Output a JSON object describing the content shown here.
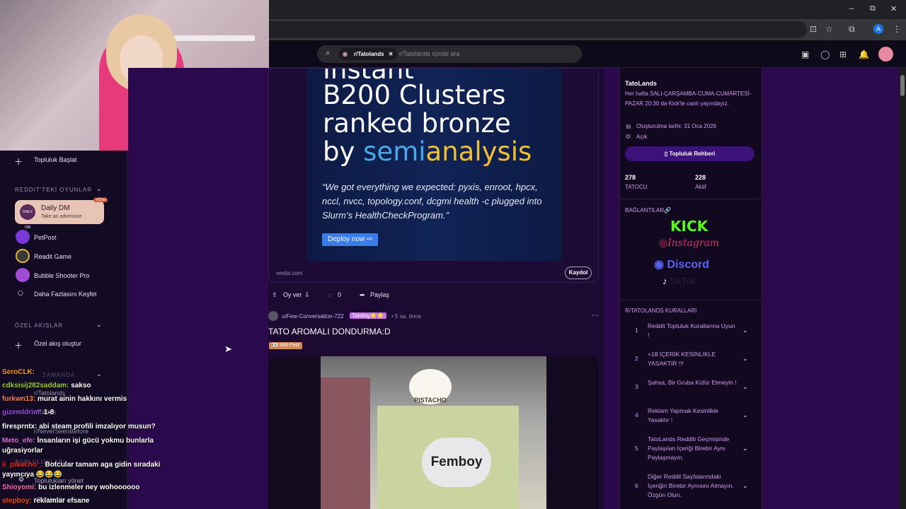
{
  "browser": {
    "minimize": "–",
    "restore": "⧉",
    "close": "✕",
    "avatar_letter": "A"
  },
  "search": {
    "community": "r/Tatolands",
    "placeholder": "r/Tatolands içinde ara"
  },
  "left_nav": {
    "start_community": "Topluluk Başlat",
    "games_header": "REDDIT'TEKİ OYUNLAR",
    "daily_dm": {
      "title": "Daily DM",
      "subtitle": "Take an adventure",
      "badge": "YENİ",
      "icon_text": "DAILY DM"
    },
    "games": [
      {
        "label": "PetPost"
      },
      {
        "label": "Readit Game"
      },
      {
        "label": "Bubble Shooter Pro"
      },
      {
        "label": "Daha Fazlasını Keşfet"
      }
    ],
    "feeds_header": "ÖZEL AKIŞLAR",
    "create_feed": "Özel akış oluştur",
    "recent_header": "ZAMANDA",
    "recent": [
      "r/Tatolands",
      "r/Twitch",
      "r/NeverSeenBefore"
    ],
    "communities_header": "TOPLULUKLAR",
    "manage": "Toplulukları yönet",
    "bottom": "r/Tatolands"
  },
  "chat": [
    {
      "user": "SeroCLK:",
      "msg": "",
      "color": "#ff9900"
    },
    {
      "user": "cdksisij282saddam:",
      "msg": "sakso",
      "color": "#9acd32"
    },
    {
      "user": "furkwn13:",
      "msg": "murat ainin hakkını vermis",
      "color": "#ff7f50"
    },
    {
      "user": "gizemldrim:",
      "msg": "1-8",
      "color": "#8a2be2"
    },
    {
      "user": "firesprntx:",
      "msg": "abi steam profili imzalıyor musun?",
      "color": "#ffffff"
    },
    {
      "user": "Meto_efe:",
      "msg": "İnsanların işi gücü yokmu bunlarla uğrasiyorlar",
      "color": "#da70d6"
    },
    {
      "user": "ii_pikacho_:",
      "msg": "Botcular tamam aga gidin sıradaki yayıncıya 😂😂😂",
      "color": "#ff0000"
    },
    {
      "user": "Shioyomi:",
      "msg": "bu izlenmeler ney wohoooooo",
      "color": "#ff69b4"
    },
    {
      "user": "stepboy:",
      "msg": "reklamlar efsane",
      "color": "#ff4500"
    }
  ],
  "ad": {
    "title_lines": [
      "Instant",
      "B200 Clusters",
      "ranked bronze"
    ],
    "by": "by ",
    "brand_a": "semi",
    "brand_b": "analysis",
    "quote": "“We got everything we expected: pyxis, enroot, hpcx, nccl, nvcc, topology.conf, dcgmi health -c plugged into Slurm’s HealthCheckProgram.”",
    "cta": "Deploy now",
    "domain": "verda.com",
    "signup": "Kaydol"
  },
  "actions": {
    "vote": "Oy ver",
    "comments": "0",
    "share": "Paylaş"
  },
  "post": {
    "author": "u/Few-Conversation-722",
    "user_flair": "Tatolog⭐⭐",
    "time": "• 5 sa. önce",
    "more": "···",
    "title": "TATO AROMALI DONDURMA:D",
    "flair": "👀 Shit Post",
    "sign_small": "PISTACHO",
    "sign_big": "Femboy"
  },
  "sidebar": {
    "name": "TatoLands",
    "description": "Her hafta SALI-ÇARŞAMBA-CUMA-CUMARTESİ-PAZAR 20:30 da Kick'te canlı yayındayız.",
    "created": "Oluşturulma tarihi: 31 Oca 2026",
    "visibility": "Açık",
    "guide": "Topluluk Rehberi",
    "members": "278",
    "members_label": "TATOCU",
    "online": "228",
    "online_label": "Aktif",
    "links_header": "BAĞLANTILAR🔗",
    "links": [
      "KICK",
      "Instagram",
      "Discord",
      "TikTok"
    ],
    "rules_header": "R/TATOLANDS KURALLARI",
    "rules": [
      {
        "n": "1",
        "t": "Reddit Topluluk Kurallarına Uyun !"
      },
      {
        "n": "2",
        "t": "+18 İÇERİK KESİNLİKLE YASAKTIR !!!"
      },
      {
        "n": "3",
        "t": "Şahsa, Bir Gruba Küfür Etmeyin !"
      },
      {
        "n": "4",
        "t": "Reklam Yapmak Kesinlikle Yasaktır !"
      },
      {
        "n": "5",
        "t": "TatoLands Redditi Geçmişinde Paylaşılan İçeriği Birebir Aynı Paylaşmayın."
      },
      {
        "n": "6",
        "t": "Diğer Reddit Sayfalarındaki İçeriğin Birebir Aynısını Almayın. Özgün Olun."
      }
    ]
  },
  "colors": {
    "accent": "#3d117a",
    "kick": "#53fc18",
    "discord": "#5865f2",
    "instagram": "#e1306c"
  }
}
